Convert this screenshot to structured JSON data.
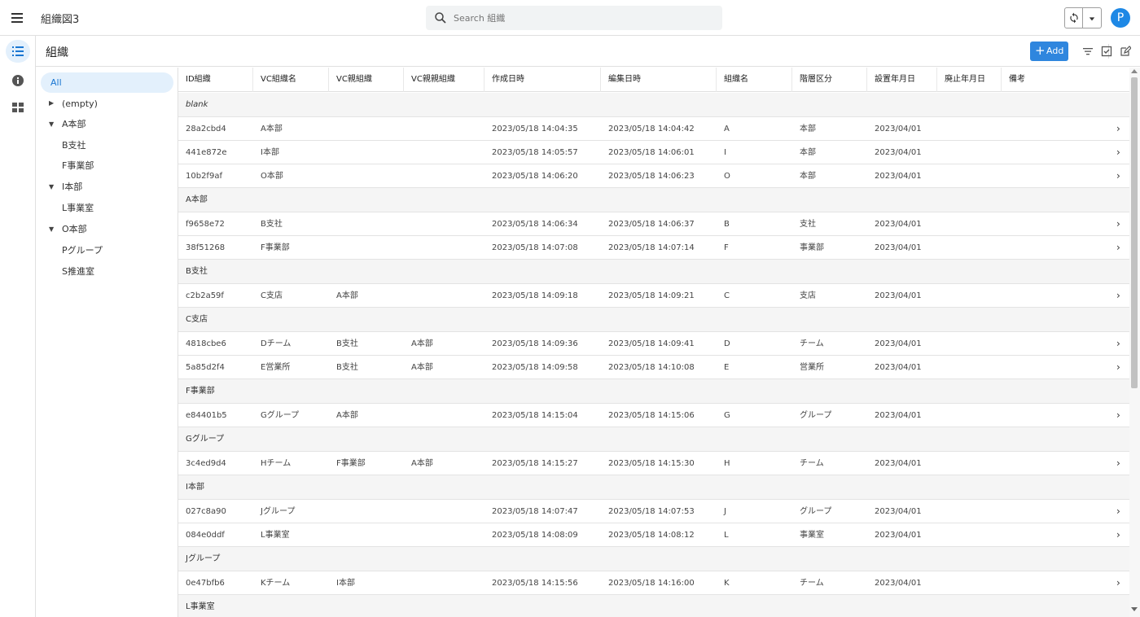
{
  "app": {
    "title": "組織図3",
    "avatar_letter": "P",
    "accent": "#2f86de"
  },
  "search": {
    "placeholder": "Search 組織",
    "value": ""
  },
  "rail": {
    "items": [
      "list-icon",
      "info-icon",
      "dashboard-icon"
    ]
  },
  "page": {
    "title": "組織",
    "add_label": "Add"
  },
  "tree": {
    "all_label": "All",
    "items": [
      {
        "label": "(empty)"
      },
      {
        "label": "A本部"
      },
      {
        "label": "B支社"
      },
      {
        "label": "F事業部"
      },
      {
        "label": "I本部"
      },
      {
        "label": "L事業室"
      },
      {
        "label": "O本部"
      },
      {
        "label": "Pグループ"
      },
      {
        "label": "S推進室"
      }
    ]
  },
  "table": {
    "columns": [
      "ID組織",
      "VC組織名",
      "VC親組織",
      "VC親親組織",
      "作成日時",
      "編集日時",
      "組織名",
      "階層区分",
      "設置年月日",
      "廃止年月日",
      "備考"
    ],
    "groups": [
      {
        "label": "blank"
      },
      {
        "label": "A本部"
      },
      {
        "label": "B支社"
      },
      {
        "label": "C支店"
      },
      {
        "label": "F事業部"
      },
      {
        "label": "Gグループ"
      },
      {
        "label": "I本部"
      },
      {
        "label": "Jグループ"
      },
      {
        "label": "L事業室"
      }
    ],
    "rows": [
      [
        "28a2cbd4",
        "A本部",
        "",
        "",
        "2023/05/18 14:04:35",
        "2023/05/18 14:04:42",
        "A",
        "本部",
        "2023/04/01",
        "",
        ""
      ],
      [
        "441e872e",
        "I本部",
        "",
        "",
        "2023/05/18 14:05:57",
        "2023/05/18 14:06:01",
        "I",
        "本部",
        "2023/04/01",
        "",
        ""
      ],
      [
        "10b2f9af",
        "O本部",
        "",
        "",
        "2023/05/18 14:06:20",
        "2023/05/18 14:06:23",
        "O",
        "本部",
        "2023/04/01",
        "",
        ""
      ],
      [
        "f9658e72",
        "B支社",
        "",
        "",
        "2023/05/18 14:06:34",
        "2023/05/18 14:06:37",
        "B",
        "支社",
        "2023/04/01",
        "",
        ""
      ],
      [
        "38f51268",
        "F事業部",
        "",
        "",
        "2023/05/18 14:07:08",
        "2023/05/18 14:07:14",
        "F",
        "事業部",
        "2023/04/01",
        "",
        ""
      ],
      [
        "c2b2a59f",
        "C支店",
        "A本部",
        "",
        "2023/05/18 14:09:18",
        "2023/05/18 14:09:21",
        "C",
        "支店",
        "2023/04/01",
        "",
        ""
      ],
      [
        "4818cbe6",
        "Dチーム",
        "B支社",
        "A本部",
        "2023/05/18 14:09:36",
        "2023/05/18 14:09:41",
        "D",
        "チーム",
        "2023/04/01",
        "",
        ""
      ],
      [
        "5a85d2f4",
        "E営業所",
        "B支社",
        "A本部",
        "2023/05/18 14:09:58",
        "2023/05/18 14:10:08",
        "E",
        "営業所",
        "2023/04/01",
        "",
        ""
      ],
      [
        "e84401b5",
        "Gグループ",
        "A本部",
        "",
        "2023/05/18 14:15:04",
        "2023/05/18 14:15:06",
        "G",
        "グループ",
        "2023/04/01",
        "",
        ""
      ],
      [
        "3c4ed9d4",
        "Hチーム",
        "F事業部",
        "A本部",
        "2023/05/18 14:15:27",
        "2023/05/18 14:15:30",
        "H",
        "チーム",
        "2023/04/01",
        "",
        ""
      ],
      [
        "027c8a90",
        "Jグループ",
        "",
        "",
        "2023/05/18 14:07:47",
        "2023/05/18 14:07:53",
        "J",
        "グループ",
        "2023/04/01",
        "",
        ""
      ],
      [
        "084e0ddf",
        "L事業室",
        "",
        "",
        "2023/05/18 14:08:09",
        "2023/05/18 14:08:12",
        "L",
        "事業室",
        "2023/04/01",
        "",
        ""
      ],
      [
        "0e47bfb6",
        "Kチーム",
        "I本部",
        "",
        "2023/05/18 14:15:56",
        "2023/05/18 14:16:00",
        "K",
        "チーム",
        "2023/04/01",
        "",
        ""
      ]
    ]
  }
}
